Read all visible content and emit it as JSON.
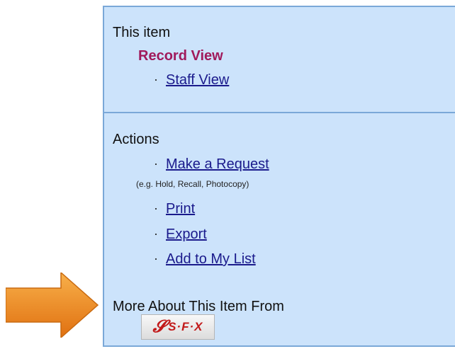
{
  "this_item": {
    "heading": "This item",
    "current_view": "Record View",
    "links": [
      {
        "label": "Staff View"
      }
    ]
  },
  "actions": {
    "heading": "Actions",
    "items": [
      {
        "label": "Make a Request"
      },
      {
        "label": "Print"
      },
      {
        "label": "Export"
      },
      {
        "label": "Add to My List"
      }
    ],
    "request_note": "(e.g. Hold, Recall, Photocopy)"
  },
  "more_about": {
    "heading": "More About This Item From",
    "sfx_label": "S·F·X"
  },
  "bullet": "·",
  "colors": {
    "panel_bg": "#cce3fb",
    "panel_border": "#7aa8d8",
    "current_view": "#a0195b",
    "link": "#1a1a8c",
    "arrow": "#f28a1e"
  },
  "icons": {
    "arrow": "right-arrow-icon",
    "sfx": "sfx-logo-icon"
  }
}
